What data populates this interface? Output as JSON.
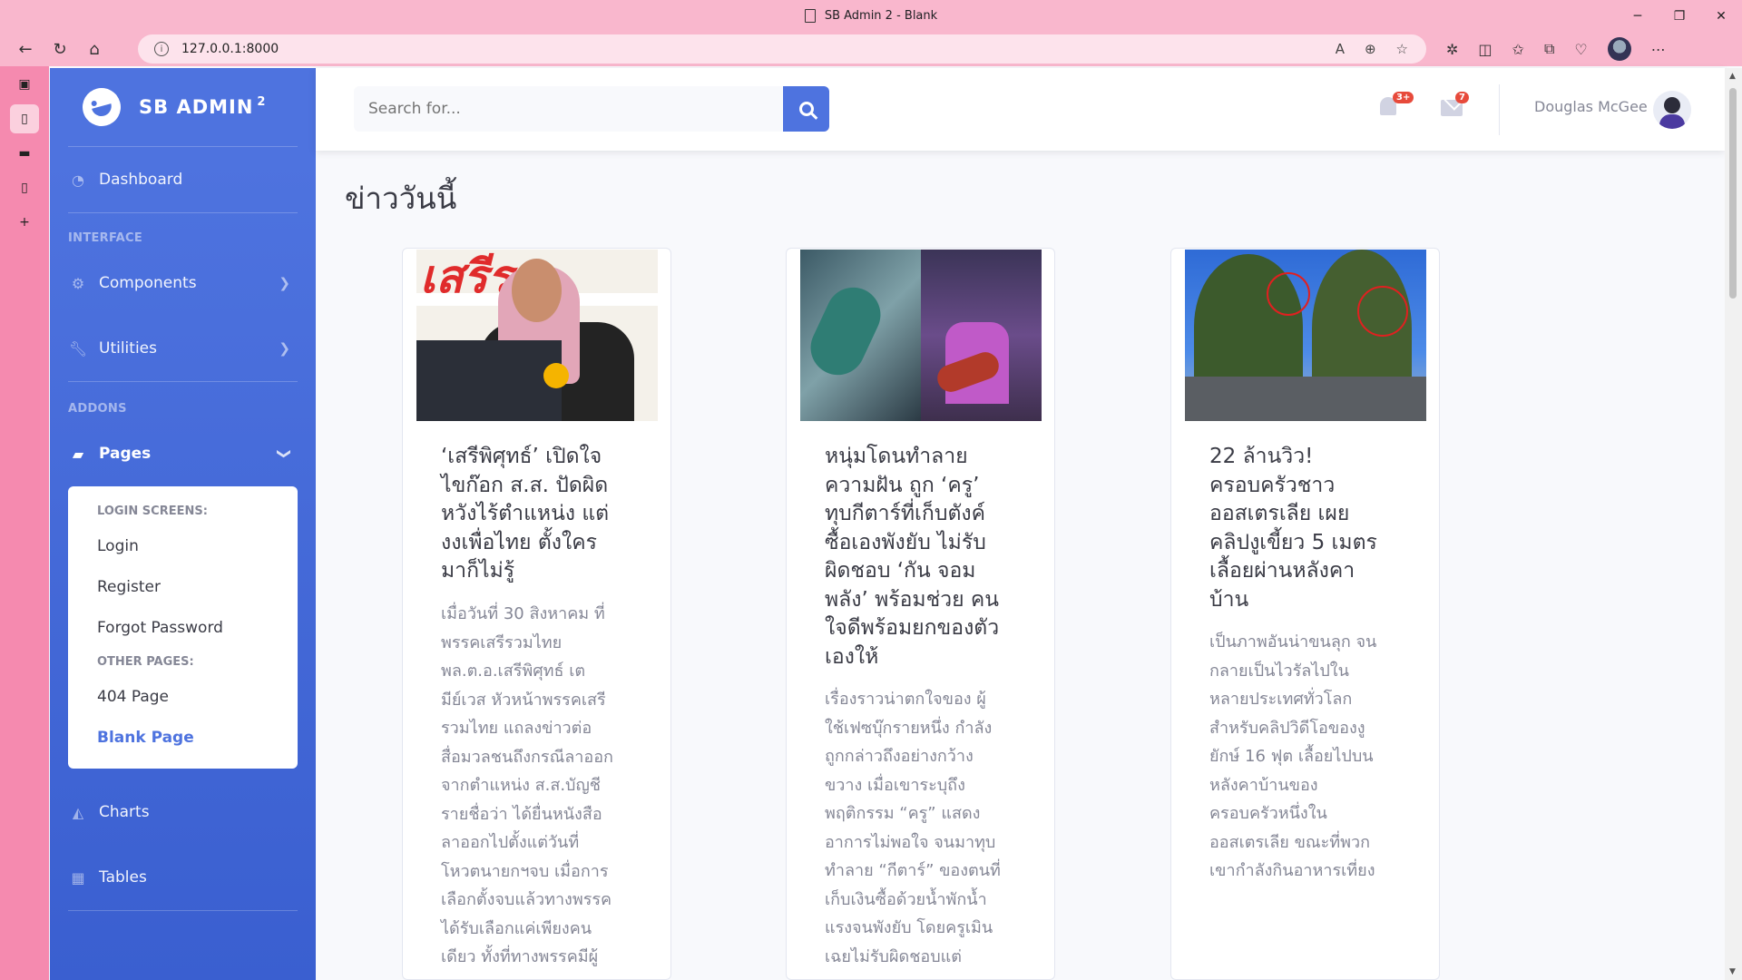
{
  "browser": {
    "window_title": "SB Admin 2 - Blank",
    "url": "127.0.0.1:8000"
  },
  "sidebar": {
    "brand": "SB ADMIN",
    "brand_sup": "2",
    "dashboard": "Dashboard",
    "heading_interface": "INTERFACE",
    "components": "Components",
    "utilities": "Utilities",
    "heading_addons": "ADDONS",
    "pages": "Pages",
    "collapse": {
      "login_heading": "LOGIN SCREENS:",
      "login": "Login",
      "register": "Register",
      "forgot": "Forgot Password",
      "other_heading": "OTHER PAGES:",
      "p404": "404 Page",
      "blank": "Blank Page"
    },
    "charts": "Charts",
    "tables": "Tables"
  },
  "topbar": {
    "search_placeholder": "Search for...",
    "alerts_badge": "3+",
    "messages_badge": "7",
    "user_name": "Douglas McGee"
  },
  "main": {
    "page_title": "ข่าววันนี้",
    "cards": [
      {
        "title_lines": [
          "‘เสรีพิศุทธ์’ เปิดใจ",
          "ไขก๊อก ส.ส. ปัดผิด",
          "หวังไร้ตำแหน่ง แต่",
          "งงเพื่อไทย ตั้งใคร",
          "มาก็ไม่รู้"
        ],
        "text_lines": [
          "เมื่อวันที่ 30 สิงหาคม ที่",
          "พรรคเสรีรวมไทย",
          "พล.ต.อ.เสรีพิศุทธ์ เต",
          "มีย์เวส หัวหน้าพรรคเสรี",
          "รวมไทย แถลงข่าวต่อ",
          "สื่อมวลชนถึงกรณีลาออก",
          "จากตำแหน่ง ส.ส.บัญชี",
          "รายชื่อว่า ได้ยื่นหนังสือ",
          "ลาออกไปตั้งแต่วันที่",
          "โหวตนายกฯจบ เมื่อการ",
          "เลือกตั้งจบแล้วทางพรรค",
          "ได้รับเลือกแค่เพียงคน",
          "เดียว ทั้งที่ทางพรรคมีผู้"
        ]
      },
      {
        "title_lines": [
          "หนุ่มโดนทำลาย",
          "ความฝัน ถูก ‘ครู’",
          "ทุบกีตาร์ที่เก็บตังค์",
          "ซื้อเองพังยับ ไม่รับ",
          "ผิดชอบ ‘กัน จอม",
          "พลัง’ พร้อมช่วย คน",
          "ใจดีพร้อมยกของตัว",
          "เองให้"
        ],
        "text_lines": [
          "เรื่องราวน่าตกใจของ ผู้",
          "ใช้เฟซบุ๊กรายหนึ่ง กำลัง",
          "ถูกกล่าวถึงอย่างกว้าง",
          "ขวาง เมื่อเขาระบุถึง",
          "พฤติกรรม “ครู” แสดง",
          "อาการไม่พอใจ จนมาทุบ",
          "ทำลาย “กีตาร์” ของตนที่",
          "เก็บเงินซื้อด้วยน้ำพักน้ำ",
          "แรงจนพังยับ โดยครูเมิน",
          "เฉยไม่รับผิดชอบแต่"
        ]
      },
      {
        "title_lines": [
          "22 ล้านวิว!",
          "ครอบครัวชาว",
          "ออสเตรเลีย เผย",
          "คลิปงูเขี้ยว 5 เมตร",
          "เลื้อยผ่านหลังคา",
          "บ้าน"
        ],
        "text_lines": [
          "เป็นภาพอันน่าขนลุก จน",
          "กลายเป็นไวรัลไปใน",
          "หลายประเทศทั่วโลก",
          "สำหรับคลิปวิดีโอของงู",
          "ยักษ์ 16 ฟุต เลื้อยไปบน",
          "หลังคาบ้านของ",
          "ครอบครัวหนึ่งใน",
          "ออสเตรเลีย ขณะที่พวก",
          "เขากำลังกินอาหารเที่ยง"
        ]
      }
    ]
  }
}
